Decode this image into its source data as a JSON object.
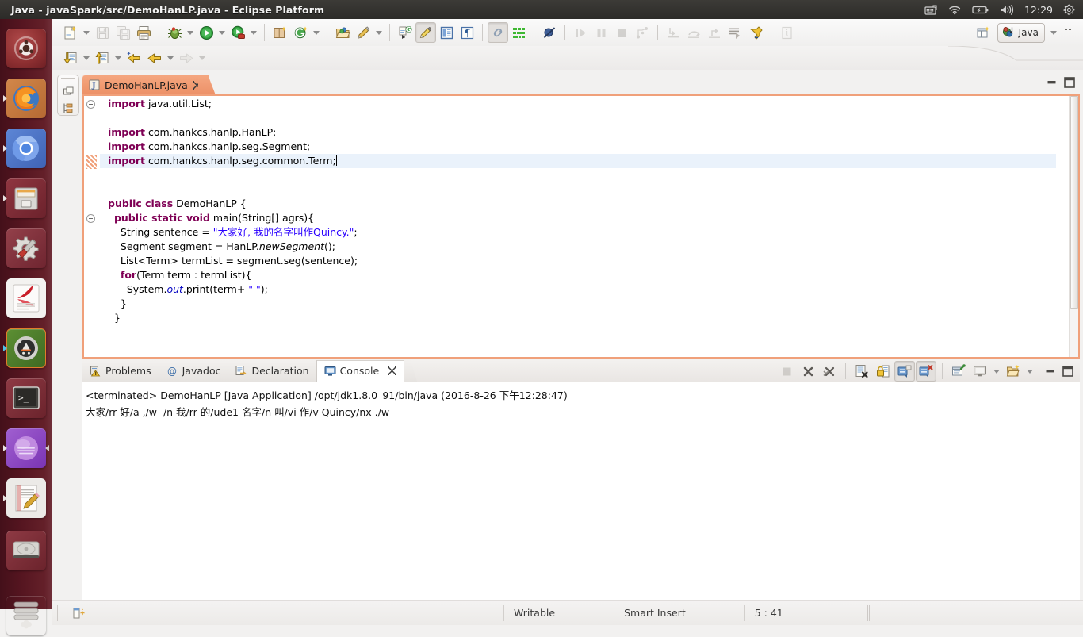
{
  "window": {
    "title": "Java - javaSpark/src/DemoHanLP.java - Eclipse Platform"
  },
  "top_panel": {
    "clock": "12:29",
    "icons": [
      "keyboard-icon",
      "wifi-icon",
      "battery-icon",
      "volume-icon",
      "gear-icon"
    ]
  },
  "launcher": {
    "items": [
      {
        "name": "ubuntu-dash",
        "label": "Ubuntu Dash"
      },
      {
        "name": "firefox",
        "label": "Firefox"
      },
      {
        "name": "chromium",
        "label": "Chromium"
      },
      {
        "name": "files",
        "label": "Files"
      },
      {
        "name": "settings",
        "label": "System Settings"
      },
      {
        "name": "pdf-reader",
        "label": "Document Viewer"
      },
      {
        "name": "android-studio",
        "label": "Android Studio"
      },
      {
        "name": "terminal",
        "label": "Terminal"
      },
      {
        "name": "eclipse",
        "label": "Eclipse"
      },
      {
        "name": "text-editor",
        "label": "Text Editor"
      },
      {
        "name": "disk-drive",
        "label": "Disk"
      },
      {
        "name": "trash",
        "label": "Trash"
      }
    ]
  },
  "toolbar": {
    "row1": [
      {
        "name": "new-wizard-button",
        "icon": "new-file-icon",
        "enabled": true,
        "caret": true
      },
      {
        "name": "save-button",
        "icon": "save-icon",
        "enabled": false,
        "caret": false
      },
      {
        "name": "save-all-button",
        "icon": "save-all-icon",
        "enabled": false,
        "caret": false
      },
      {
        "name": "print-button",
        "icon": "print-icon",
        "enabled": true,
        "caret": false
      },
      {
        "name": "debug-button",
        "icon": "debug-bug-icon",
        "enabled": true,
        "caret": true
      },
      {
        "name": "run-button",
        "icon": "run-play-icon",
        "enabled": true,
        "caret": true
      },
      {
        "name": "coverage-button",
        "icon": "coverage-icon",
        "enabled": true,
        "caret": true
      },
      {
        "name": "new-java-package-button",
        "icon": "new-package-icon",
        "enabled": true,
        "caret": false
      },
      {
        "name": "new-java-class-button",
        "icon": "new-class-icon",
        "enabled": true,
        "caret": true
      },
      {
        "name": "open-type-button",
        "icon": "open-type-icon",
        "enabled": true,
        "caret": false
      },
      {
        "name": "search-button",
        "icon": "search-pencil-icon",
        "enabled": true,
        "caret": true
      },
      {
        "name": "next-annotation-button",
        "icon": "next-annotation-icon",
        "enabled": true,
        "caret": false
      },
      {
        "name": "toggle-mark-occurrences-button",
        "icon": "highlighter-icon",
        "enabled": true,
        "pressed": true
      },
      {
        "name": "toggle-block-selection-button",
        "icon": "block-selection-icon",
        "enabled": true,
        "caret": false
      },
      {
        "name": "show-whitespace-button",
        "icon": "pilcrow-icon",
        "enabled": true,
        "caret": false
      },
      {
        "name": "link-with-editor-button",
        "icon": "link-icon",
        "enabled": true,
        "pressed": true
      },
      {
        "name": "open-task-button",
        "icon": "task-list-icon",
        "enabled": true,
        "caret": false
      },
      {
        "name": "skip-breakpoints-button",
        "icon": "skip-breakpoints-icon",
        "enabled": true,
        "caret": false
      },
      {
        "name": "resume-button",
        "icon": "resume-icon",
        "enabled": false,
        "caret": false
      },
      {
        "name": "suspend-button",
        "icon": "suspend-icon",
        "enabled": false,
        "caret": false
      },
      {
        "name": "terminate-button",
        "icon": "terminate-icon",
        "enabled": false,
        "caret": false
      },
      {
        "name": "disconnect-button",
        "icon": "disconnect-icon",
        "enabled": false,
        "caret": false
      },
      {
        "name": "step-into-button",
        "icon": "step-into-icon",
        "enabled": false,
        "caret": false
      },
      {
        "name": "step-over-button",
        "icon": "step-over-icon",
        "enabled": false,
        "caret": false
      },
      {
        "name": "step-return-button",
        "icon": "step-return-icon",
        "enabled": false,
        "caret": false
      },
      {
        "name": "drop-to-frame-button",
        "icon": "drop-to-frame-icon",
        "enabled": true,
        "caret": false
      },
      {
        "name": "external-tools-button",
        "icon": "external-tools-icon",
        "enabled": true,
        "caret": false
      },
      {
        "name": "info-button",
        "icon": "info-icon",
        "enabled": false,
        "caret": false
      }
    ],
    "row2": [
      {
        "name": "next-edit-location-button",
        "icon": "down-arrow-doc-icon",
        "caret": true
      },
      {
        "name": "previous-edit-location-button",
        "icon": "up-arrow-doc-icon",
        "caret": true
      },
      {
        "name": "back-to-last-edit-button",
        "icon": "back-star-arrow-icon",
        "caret": false
      },
      {
        "name": "back-button",
        "icon": "back-arrow-icon",
        "caret": true
      },
      {
        "name": "forward-button",
        "icon": "forward-arrow-icon",
        "caret": true,
        "enabled": false
      }
    ],
    "perspective": {
      "open_perspective_name": "open-perspective-button",
      "active_label": "Java",
      "caret": "chevron-down-icon"
    }
  },
  "minimized_views": [
    {
      "name": "package-explorer-minimized",
      "icon": "package-explorer-icon"
    },
    {
      "name": "hierarchy-minimized",
      "icon": "hierarchy-icon"
    }
  ],
  "editor": {
    "tab": {
      "label": "DemoHanLP.java",
      "icon": "java-file-icon",
      "close": "close-icon"
    },
    "minimize": "minimize-icon",
    "maximize": "maximize-icon",
    "lines": [
      {
        "fold": true,
        "hl": false,
        "tokens": [
          {
            "t": "import",
            "c": "kw"
          },
          {
            "t": " java.util.List;",
            "c": ""
          }
        ]
      },
      {
        "fold": false,
        "hl": false,
        "tokens": []
      },
      {
        "fold": false,
        "hl": false,
        "tokens": [
          {
            "t": "import",
            "c": "kw"
          },
          {
            "t": " com.hankcs.hanlp.HanLP;",
            "c": ""
          }
        ]
      },
      {
        "fold": false,
        "hl": false,
        "tokens": [
          {
            "t": "import",
            "c": "kw"
          },
          {
            "t": " com.hankcs.hanlp.seg.Segment;",
            "c": ""
          }
        ]
      },
      {
        "fold": false,
        "hl": true,
        "tokens": [
          {
            "t": "import",
            "c": "kw"
          },
          {
            "t": " com.hankcs.hanlp.seg.common.Term;",
            "c": ""
          }
        ]
      },
      {
        "fold": false,
        "hl": false,
        "tokens": []
      },
      {
        "fold": false,
        "hl": false,
        "tokens": []
      },
      {
        "fold": false,
        "hl": false,
        "tokens": [
          {
            "t": "public class",
            "c": "kw"
          },
          {
            "t": " DemoHanLP {",
            "c": ""
          }
        ]
      },
      {
        "fold": true,
        "hl": false,
        "tokens": [
          {
            "t": "  ",
            "c": ""
          },
          {
            "t": "public static void",
            "c": "kw"
          },
          {
            "t": " main(String[] agrs){",
            "c": ""
          }
        ]
      },
      {
        "fold": false,
        "hl": false,
        "tokens": [
          {
            "t": "    String sentence = ",
            "c": ""
          },
          {
            "t": "\"大家好, 我的名字叫作Quincy.\"",
            "c": "str"
          },
          {
            "t": ";",
            "c": ""
          }
        ]
      },
      {
        "fold": false,
        "hl": false,
        "tokens": [
          {
            "t": "    Segment segment = HanLP.",
            "c": ""
          },
          {
            "t": "newSegment",
            "c": "stat"
          },
          {
            "t": "();",
            "c": ""
          }
        ]
      },
      {
        "fold": false,
        "hl": false,
        "tokens": [
          {
            "t": "    List<Term> termList = segment.seg(sentence);",
            "c": ""
          }
        ]
      },
      {
        "fold": false,
        "hl": false,
        "tokens": [
          {
            "t": "    ",
            "c": ""
          },
          {
            "t": "for",
            "c": "kw"
          },
          {
            "t": "(Term term : termList){",
            "c": ""
          }
        ]
      },
      {
        "fold": false,
        "hl": false,
        "tokens": [
          {
            "t": "      System.",
            "c": ""
          },
          {
            "t": "out",
            "c": "statf"
          },
          {
            "t": ".print(term+ ",
            "c": ""
          },
          {
            "t": "\" \"",
            "c": "str"
          },
          {
            "t": ");",
            "c": ""
          }
        ]
      },
      {
        "fold": false,
        "hl": false,
        "tokens": [
          {
            "t": "    }",
            "c": ""
          }
        ]
      },
      {
        "fold": false,
        "hl": false,
        "tokens": [
          {
            "t": "  }",
            "c": ""
          }
        ]
      }
    ]
  },
  "console_panel": {
    "tabs": [
      {
        "label": "Problems",
        "icon": "problems-icon",
        "active": false,
        "closable": false
      },
      {
        "label": "Javadoc",
        "icon": "javadoc-at-icon",
        "active": false,
        "closable": false
      },
      {
        "label": "Declaration",
        "icon": "declaration-icon",
        "active": false,
        "closable": false
      },
      {
        "label": "Console",
        "icon": "console-icon",
        "active": true,
        "closable": true
      }
    ],
    "tools": [
      {
        "name": "terminate-console-button",
        "icon": "terminate-icon",
        "enabled": false
      },
      {
        "name": "remove-launch-button",
        "icon": "remove-x-icon",
        "enabled": true
      },
      {
        "name": "remove-all-terminated-button",
        "icon": "remove-all-x-icon",
        "enabled": true
      },
      {
        "name": "clear-console-button",
        "icon": "clear-console-icon",
        "enabled": true
      },
      {
        "name": "scroll-lock-button",
        "icon": "lock-icon",
        "enabled": true
      },
      {
        "name": "pin-console-button",
        "icon": "pin-console-icon",
        "enabled": true,
        "pressed": true
      },
      {
        "name": "display-selected-console-button",
        "icon": "display-console-icon",
        "enabled": true,
        "pressed": true
      },
      {
        "name": "open-console-button",
        "icon": "open-console-icon",
        "enabled": true
      },
      {
        "name": "select-console-button",
        "icon": "select-console-icon",
        "enabled": true,
        "caret": true
      },
      {
        "name": "view-menu-button",
        "icon": "view-menu-icon",
        "enabled": true,
        "caret": true
      },
      {
        "name": "minimize-panel-button",
        "icon": "minimize-icon",
        "enabled": true
      },
      {
        "name": "maximize-panel-button",
        "icon": "maximize-icon",
        "enabled": true
      }
    ],
    "output": {
      "header": "<terminated> DemoHanLP [Java Application] /opt/jdk1.8.0_91/bin/java (2016-8-26 下午12:28:47)",
      "body": "大家/rr 好/a ,/w  /n 我/rr 的/ude1 名字/n 叫/vi 作/v Quincy/nx ./w"
    }
  },
  "statusbar": {
    "icon": "editor-indicator-icon",
    "writable": "Writable",
    "insert_mode": "Smart Insert",
    "position": "5 : 41"
  },
  "colors": {
    "tab_accent": "#f0a07a",
    "keyword": "#7f0055",
    "string": "#2a00ff",
    "static_field": "#0000c0",
    "launcher_bg": "#551520",
    "panel_bg": "#2c2b28"
  }
}
